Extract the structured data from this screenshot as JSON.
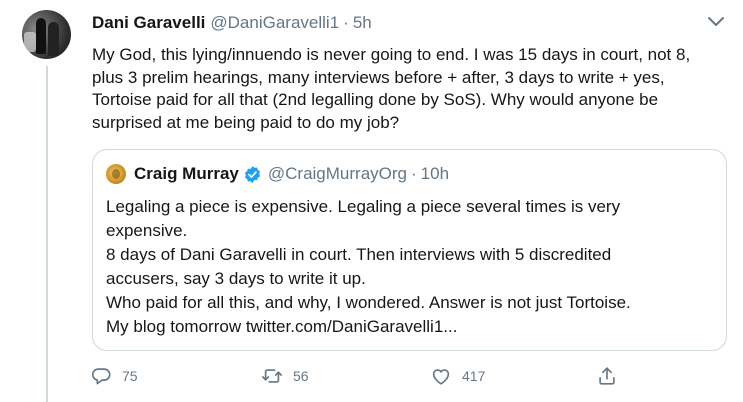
{
  "tweet": {
    "author_name": "Dani Garavelli",
    "author_handle": "@DaniGaravelli1",
    "separator": "·",
    "time": "5h",
    "text": "My God, this lying/innuendo is never going to end. I was 15 days in court, not 8, plus 3 prelim hearings, many interviews before + after, 3 days to write + yes, Tortoise paid for all that (2nd legalling done by SoS). Why would anyone be surprised at me being paid to do my job?"
  },
  "quoted": {
    "author_name": "Craig Murray",
    "author_handle": "@CraigMurrayOrg",
    "separator": "·",
    "time": "10h",
    "verified": true,
    "lines": [
      "Legaling a piece is expensive. Legaling a piece several times is very",
      "expensive.",
      "8 days of Dani Garavelli in court. Then interviews with 5 discredited",
      "accusers, say 3 days to write it up.",
      "Who paid for all this, and why, I wondered. Answer is not just Tortoise.",
      "My blog tomorrow twitter.com/DaniGaravelli1..."
    ]
  },
  "actions": {
    "reply_count": "75",
    "retweet_count": "56",
    "like_count": "417"
  },
  "icons": {
    "menu": "chevron-down-icon",
    "verified": "verified-badge-icon",
    "reply": "reply-icon",
    "retweet": "retweet-icon",
    "like": "heart-icon",
    "share": "share-icon"
  },
  "colors": {
    "accent": "#1da1f2",
    "secondary_text": "#657786",
    "primary_text": "#14171a",
    "border": "#cfd9de"
  }
}
